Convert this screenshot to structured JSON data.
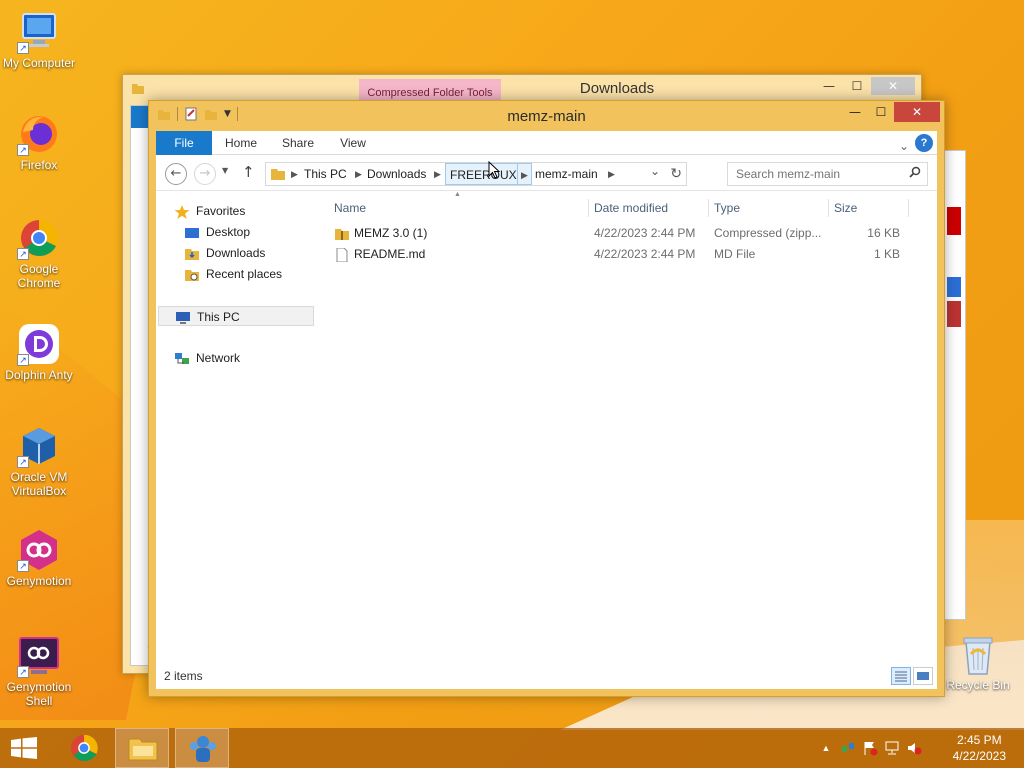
{
  "desktop": {
    "icons": [
      {
        "label": "My Computer"
      },
      {
        "label": "Firefox"
      },
      {
        "label": "Google Chrome"
      },
      {
        "label": "Dolphin Anty"
      },
      {
        "label": "Oracle VM VirtualBox"
      },
      {
        "label": "Genymotion"
      },
      {
        "label": "Genymotion Shell"
      }
    ],
    "recycle_bin": "Recycle Bin"
  },
  "background_window": {
    "title": "Downloads",
    "context_tab": "Compressed Folder Tools",
    "side_text": "1"
  },
  "window": {
    "title": "memz-main",
    "ribbon_tabs": [
      "File",
      "Home",
      "Share",
      "View"
    ],
    "breadcrumb": [
      "This PC",
      "Downloads",
      "FREEROUX",
      "memz-main"
    ],
    "search_placeholder": "Search memz-main",
    "nav": {
      "favorites": "Favorites",
      "desktop": "Desktop",
      "downloads": "Downloads",
      "recent": "Recent places",
      "this_pc": "This PC",
      "network": "Network"
    },
    "columns": [
      "Name",
      "Date modified",
      "Type",
      "Size"
    ],
    "files": [
      {
        "name": "MEMZ 3.0 (1)",
        "date": "4/22/2023 2:44 PM",
        "type": "Compressed (zipp...",
        "size": "16 KB"
      },
      {
        "name": "README.md",
        "date": "4/22/2023 2:44 PM",
        "type": "MD File",
        "size": "1 KB"
      }
    ],
    "status": "2 items"
  },
  "taskbar": {
    "time": "2:45 PM",
    "date": "4/22/2023"
  },
  "colors": {
    "window_frame": "#f2c35c",
    "file_tab": "#1979ca",
    "close_button": "#c9463d",
    "context_tab": "#f4b6c9"
  }
}
